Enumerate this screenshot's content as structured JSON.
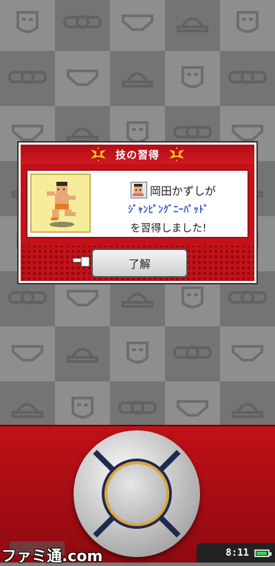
{
  "dialog": {
    "title": "技の習得",
    "character_name": "岡田かずしが",
    "skill_name": "ｼﾞｬﾝﾋﾟﾝｸﾞﾆｰﾊﾟｯﾄﾞ",
    "acquired_text": "を習得しました!",
    "ok_label": "了解"
  },
  "status": {
    "clock": "8:11",
    "battery_color": "#3ad34b"
  },
  "watermark": "ファミ通.com",
  "colors": {
    "dialog_red": "#c3121a",
    "skill_text": "#2d55c8",
    "portrait_bg": "#f6ec9c"
  }
}
